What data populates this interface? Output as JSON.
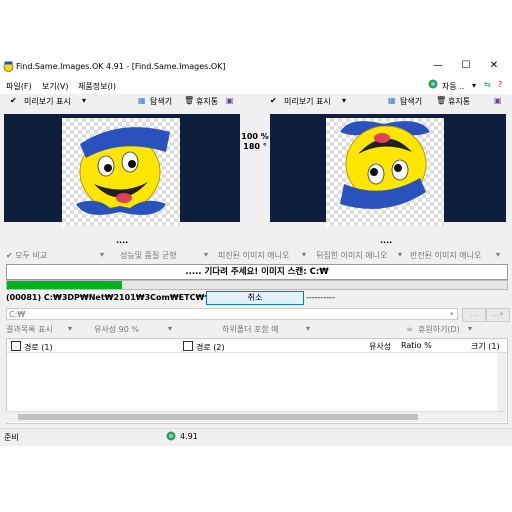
{
  "window": {
    "title": "Find.Same.Images.OK 4.91  -  [Find.Same.Images.OK]",
    "minimize_glyph": "—",
    "maximize_glyph": "☐",
    "close_glyph": "✕"
  },
  "menu": {
    "items": [
      "파일(F)",
      "보기(V)",
      "제품정보(I)"
    ],
    "right_label": "자동 .."
  },
  "left_toolbar": {
    "preview_label": "미리보기 표시",
    "explorer_label": "탐색기",
    "trash_label": "휴지통"
  },
  "right_toolbar": {
    "preview_label": "미리보기 표시",
    "explorer_label": "탐색기",
    "trash_label": "휴지통"
  },
  "compare": {
    "zoom": "100 %",
    "rotation": "180 °"
  },
  "dots": "....",
  "options": [
    "모두 비교",
    "성능및 품질 균형",
    "피진된 이미지 애니오",
    "뒤집힌 이미지 애니오",
    "반전된 이미지 애니오"
  ],
  "status_banner": "..... 기다려 주세요! 이미지 스캔: C:₩",
  "progress": {
    "value": 0.23
  },
  "scan_path": "(00081) C:₩3DP₩Net₩2101₩3Com₩ETC₩*.*",
  "scan_path_suffix": "----------",
  "cancel_label": "취소",
  "dir_field": "C:₩",
  "small_buttons": [
    "...",
    "...+"
  ],
  "filters": {
    "result_list": "결과목록 표시",
    "similarity": "유사성 90 %",
    "include_subfolders": "하위폴더 포함 예",
    "recycle": "휴원하기(D)"
  },
  "table": {
    "headers": {
      "path1": "경로 (1)",
      "path2": "경로 (2)",
      "similarity": "유사성",
      "ratio": "Ratio %",
      "size": "크기 (1)"
    }
  },
  "statusbar": {
    "left": "준비",
    "version": "4.91"
  },
  "colors": {
    "panel_bg": "#0e1f3e",
    "progress": "#06b025",
    "accent": "#0078d7"
  }
}
